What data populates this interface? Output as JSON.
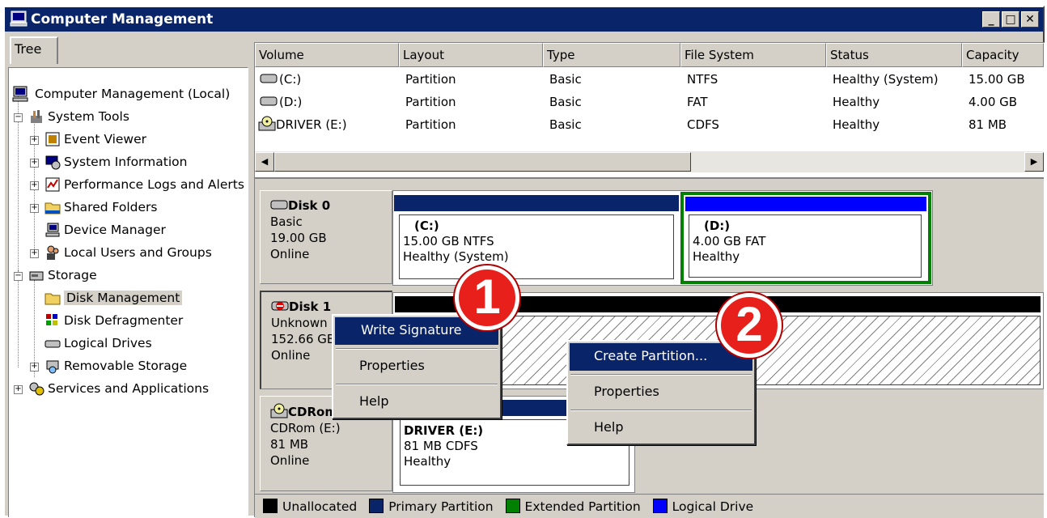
{
  "window": {
    "title": "Computer Management"
  },
  "tree": {
    "tab": "Tree",
    "items": [
      {
        "label": "Computer Management (Local)",
        "icon": "computer-icon"
      },
      {
        "label": "System Tools",
        "icon": "tools-icon"
      },
      {
        "label": "Event Viewer",
        "icon": "event-viewer-icon"
      },
      {
        "label": "System Information",
        "icon": "system-info-icon"
      },
      {
        "label": "Performance Logs and Alerts",
        "icon": "performance-icon"
      },
      {
        "label": "Shared Folders",
        "icon": "folder-icon"
      },
      {
        "label": "Device Manager",
        "icon": "device-manager-icon"
      },
      {
        "label": "Local Users and Groups",
        "icon": "users-icon"
      },
      {
        "label": "Storage",
        "icon": "storage-icon"
      },
      {
        "label": "Disk Management",
        "icon": "disk-management-icon"
      },
      {
        "label": "Disk Defragmenter",
        "icon": "defrag-icon"
      },
      {
        "label": "Logical Drives",
        "icon": "drive-icon"
      },
      {
        "label": "Removable Storage",
        "icon": "removable-storage-icon"
      },
      {
        "label": "Services and Applications",
        "icon": "services-icon"
      }
    ]
  },
  "volumes": {
    "columns": [
      "Volume",
      "Layout",
      "Type",
      "File System",
      "Status",
      "Capacity"
    ],
    "rows": [
      [
        "(C:)",
        "Partition",
        "Basic",
        "NTFS",
        "Healthy (System)",
        "15.00 GB"
      ],
      [
        "(D:)",
        "Partition",
        "Basic",
        "FAT",
        "Healthy",
        "4.00 GB"
      ],
      [
        "DRIVER (E:)",
        "Partition",
        "Basic",
        "CDFS",
        "Healthy",
        "81 MB"
      ]
    ]
  },
  "disks": {
    "disk0": {
      "name": "Disk 0",
      "type": "Basic",
      "size": "19.00 GB",
      "status": "Online"
    },
    "disk1": {
      "name": "Disk 1",
      "type": "Unknown",
      "size": "152.66 GB",
      "status": "Online"
    },
    "cdrom": {
      "name": "CDRom 0",
      "type": "CDRom (E:)",
      "size": "81 MB",
      "status": "Online"
    }
  },
  "partitions": {
    "c": {
      "name": "(C:)",
      "detail": "15.00 GB NTFS",
      "status": "Healthy (System)"
    },
    "d": {
      "name": "(D:)",
      "detail": "4.00 GB FAT",
      "status": "Healthy"
    },
    "e": {
      "name": "DRIVER  (E:)",
      "detail": "81 MB CDFS",
      "status": "Healthy"
    }
  },
  "menu1": {
    "write_signature": "Write Signature",
    "properties": "Properties",
    "help": "Help"
  },
  "menu2": {
    "create_partition": "Create Partition...",
    "properties": "Properties",
    "help": "Help"
  },
  "legend": {
    "unallocated": "Unallocated",
    "primary": "Primary Partition",
    "extended": "Extended Partition",
    "logical": "Logical Drive"
  },
  "callouts": {
    "one": "1",
    "two": "2"
  },
  "colors": {
    "title_bar": "#0a246a",
    "primary": "#0a246a",
    "extended": "#008000",
    "logical": "#0000ff",
    "unallocated": "#000000",
    "callout": "#e8201c"
  }
}
